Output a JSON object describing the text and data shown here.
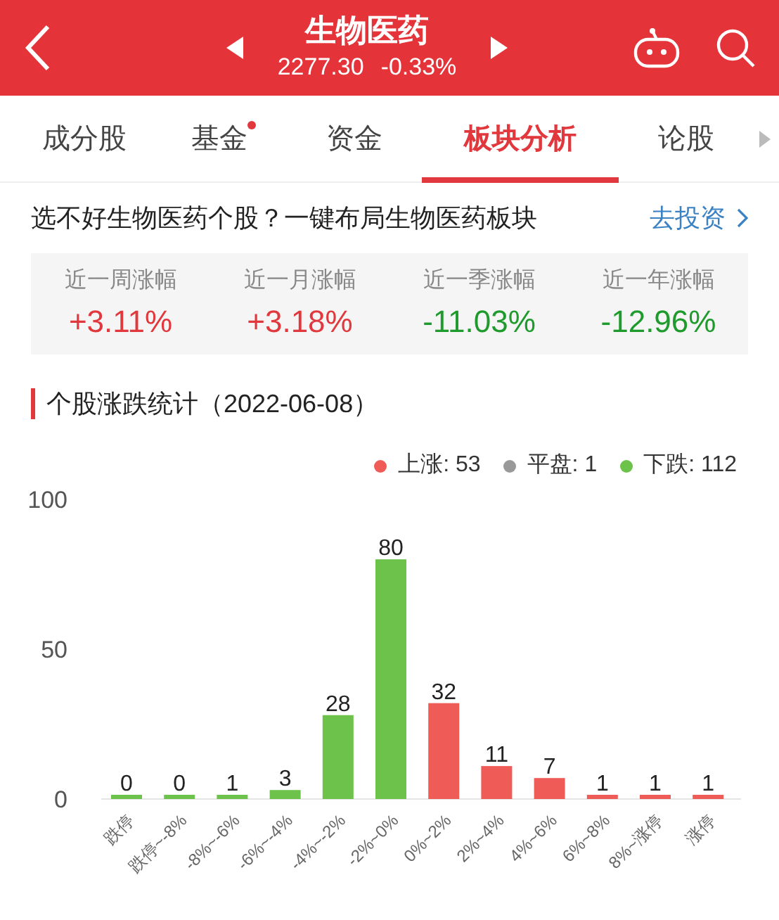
{
  "header": {
    "title": "生物医药",
    "price": "2277.30",
    "change": "-0.33%"
  },
  "tabs": [
    {
      "label": "成分股",
      "selected": false,
      "dot": false
    },
    {
      "label": "基金",
      "selected": false,
      "dot": true
    },
    {
      "label": "资金",
      "selected": false,
      "dot": false
    },
    {
      "label": "板块分析",
      "selected": true,
      "dot": false
    },
    {
      "label": "论股",
      "selected": false,
      "dot": false
    }
  ],
  "promo": {
    "text": "选不好生物医药个股？一键布局生物医药板块",
    "link": "去投资"
  },
  "stats": [
    {
      "label": "近一周涨幅",
      "value": "+3.11%",
      "color": "#e0383d"
    },
    {
      "label": "近一月涨幅",
      "value": "+3.18%",
      "color": "#e0383d"
    },
    {
      "label": "近一季涨幅",
      "value": "-11.03%",
      "color": "#1f9a2c"
    },
    {
      "label": "近一年涨幅",
      "value": "-12.96%",
      "color": "#1f9a2c"
    }
  ],
  "section_title": "个股涨跌统计（2022-06-08）",
  "legend": [
    {
      "label": "上涨: 53",
      "color": "#ef5b57"
    },
    {
      "label": "平盘: 1",
      "color": "#999999"
    },
    {
      "label": "下跌: 112",
      "color": "#6cc24a"
    }
  ],
  "chart_data": {
    "type": "bar",
    "categories": [
      "跌停",
      "跌停~-8%",
      "-8%~-6%",
      "-6%~-4%",
      "-4%~-2%",
      "-2%~0%",
      "0%~2%",
      "2%~4%",
      "4%~6%",
      "6%~8%",
      "8%~涨停",
      "涨停"
    ],
    "series": [
      {
        "color": "#6cc24a",
        "values": [
          0,
          0,
          1,
          3,
          28,
          80,
          null,
          null,
          null,
          null,
          null,
          null
        ]
      },
      {
        "color": "#ef5b57",
        "values": [
          null,
          null,
          null,
          null,
          null,
          null,
          32,
          11,
          7,
          1,
          1,
          1
        ]
      }
    ],
    "ylim": [
      0,
      100
    ],
    "yticks": [
      0,
      50,
      100
    ],
    "data_labels": true
  }
}
